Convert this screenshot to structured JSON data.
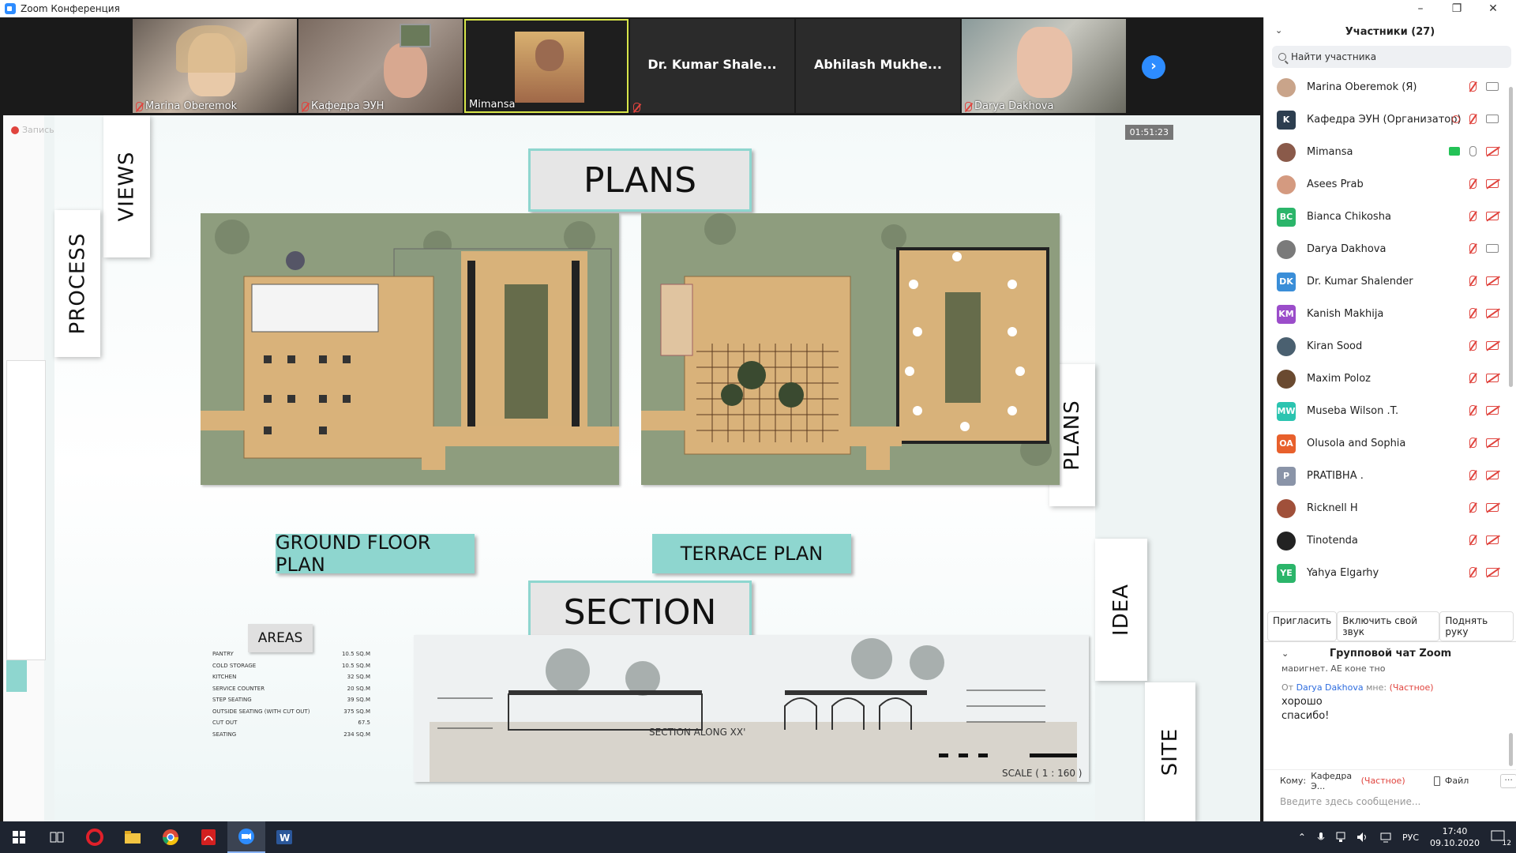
{
  "window": {
    "title": "Zoom Конференция",
    "min": "–",
    "max": "❐",
    "close": "✕"
  },
  "strip": {
    "tiles": [
      {
        "name": "Marina Oberemok",
        "muted": true
      },
      {
        "name": "Кафедра ЭУН",
        "muted": true
      },
      {
        "name": "Mimansa",
        "muted": false
      },
      {
        "name": "Dr. Kumar Shale...",
        "muted": true,
        "noVideo": true
      },
      {
        "name": "Abhilash  Mukhe...",
        "muted": false,
        "noVideo": true
      },
      {
        "name": "Darya Dakhova",
        "muted": true
      }
    ],
    "next": "›"
  },
  "share": {
    "recording": "Запись",
    "timer": "01:51:23",
    "slide": {
      "heading_plans": "PLANS",
      "heading_section": "SECTION",
      "ground": "GROUND FLOOR PLAN",
      "terrace": "TERRACE PLAN",
      "section_caption": "SECTION ALONG XX'",
      "scale": "SCALE ( 1 : 160 )",
      "tabs": {
        "views": "VIEWS",
        "process": "PROCESS",
        "plans": "PLANS",
        "idea": "IDEA",
        "site": "SITE"
      },
      "areas_title": "AREAS",
      "areas": [
        {
          "label": "PANTRY",
          "value": "10.5 SQ.M"
        },
        {
          "label": "COLD STORAGE",
          "value": "10.5 SQ.M"
        },
        {
          "label": "KITCHEN",
          "value": "32 SQ.M"
        },
        {
          "label": "SERVICE COUNTER",
          "value": "20 SQ.M"
        },
        {
          "label": "STEP SEATING",
          "value": "39 SQ.M"
        },
        {
          "label": "OUTSIDE  SEATING (WITH CUT OUT)",
          "value": "375 SQ.M"
        },
        {
          "label": "CUT OUT",
          "value": "67.5"
        },
        {
          "label": "SEATING",
          "value": "234 SQ.M"
        }
      ]
    }
  },
  "participants": {
    "header": "Участники (27)",
    "search_placeholder": "Найти участника",
    "list": [
      {
        "name": "Marina Oberemok (Я)",
        "avatar": "",
        "color": "#c9a48a",
        "mic": "off",
        "cam": "on"
      },
      {
        "name": "Кафедра ЭУН (Организатор)",
        "avatar": "K",
        "color": "#2d3e50",
        "mic": "off",
        "cam": "on",
        "rec": true
      },
      {
        "name": "Mimansa",
        "avatar": "",
        "color": "#8a5a4a",
        "mic": "on",
        "cam": "off",
        "share": true
      },
      {
        "name": "Asees Prab",
        "avatar": "",
        "color": "#d49a80",
        "mic": "off",
        "cam": "off"
      },
      {
        "name": "Bianca Chikosha",
        "avatar": "BC",
        "color": "#2bb56a",
        "mic": "off",
        "cam": "off"
      },
      {
        "name": "Darya Dakhova",
        "avatar": "",
        "color": "#7a7a7a",
        "mic": "off",
        "cam": "on"
      },
      {
        "name": "Dr. Kumar Shalender",
        "avatar": "DK",
        "color": "#3a8ed8",
        "mic": "off",
        "cam": "off"
      },
      {
        "name": "Kanish Makhija",
        "avatar": "KM",
        "color": "#9b4dca",
        "mic": "off",
        "cam": "off"
      },
      {
        "name": "Kiran Sood",
        "avatar": "",
        "color": "#4a6070",
        "mic": "off",
        "cam": "off"
      },
      {
        "name": "Maxim Poloz",
        "avatar": "",
        "color": "#6a4a30",
        "mic": "off",
        "cam": "off"
      },
      {
        "name": "Museba Wilson .T.",
        "avatar": "MW",
        "color": "#2bc4b0",
        "mic": "off",
        "cam": "off"
      },
      {
        "name": "Olusola and Sophia",
        "avatar": "OA",
        "color": "#e8602c",
        "mic": "off",
        "cam": "off"
      },
      {
        "name": "PRATIBHA .",
        "avatar": "P",
        "color": "#8a94a8",
        "mic": "off",
        "cam": "off"
      },
      {
        "name": "Ricknell H",
        "avatar": "",
        "color": "#a0503a",
        "mic": "off",
        "cam": "off"
      },
      {
        "name": "Tinotenda",
        "avatar": "",
        "color": "#222222",
        "mic": "off",
        "cam": "off"
      },
      {
        "name": "Yahya Elgarhy",
        "avatar": "YE",
        "color": "#2bb56a",
        "mic": "off",
        "cam": "off"
      }
    ],
    "buttons": {
      "invite": "Пригласить",
      "unmute": "Включить свой звук",
      "raise": "Поднять руку"
    }
  },
  "chat": {
    "header": "Групповой чат Zoom",
    "cut_text": "маригнет, AE коне тно",
    "from_prefix": "От",
    "from": "Darya Dakhova",
    "to_me": "мне:",
    "private": "(Частное)",
    "messages": [
      "хорошо",
      "спасибо!"
    ],
    "to_label": "Кому:",
    "to_name": "Кафедра Э...",
    "file": "Файл",
    "more": "···",
    "input_placeholder": "Введите здесь сообщение..."
  },
  "taskbar": {
    "lang": "РУС",
    "time": "17:40",
    "date": "09.10.2020",
    "notif": "12"
  }
}
